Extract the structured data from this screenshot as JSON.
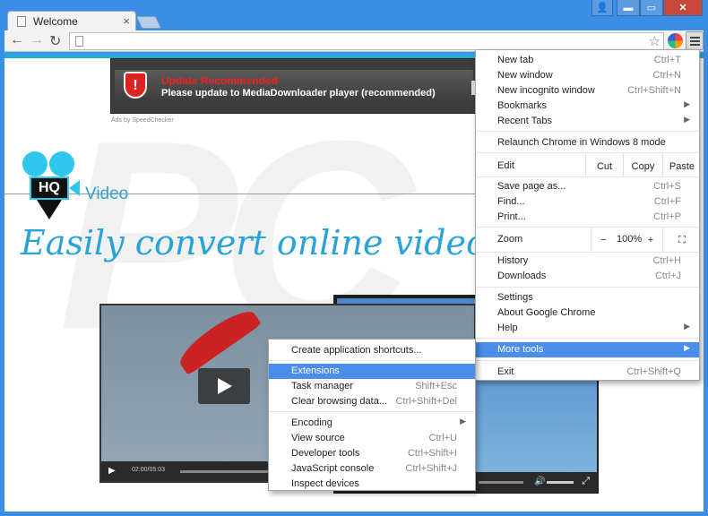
{
  "window": {
    "tab_title": "Welcome",
    "tab_close": "×",
    "controls": {
      "user": "👤",
      "minimize": "▬",
      "maximize": "▭",
      "close": "✕"
    }
  },
  "toolbar": {
    "back": "←",
    "forward": "→",
    "reload": "↻",
    "star": "☆"
  },
  "ad": {
    "title": "Update Recommended",
    "text": "Please update to MediaDownloader player (recommended)",
    "shield": "!",
    "attribution": "Ads by SpeedChecker"
  },
  "site": {
    "logo_badge": "HQ",
    "logo_text": "Video",
    "headline": "Easily convert online videos to M"
  },
  "player": {
    "play": "▶",
    "time": "02:00/05:03",
    "volume": "🔊",
    "fullscreen": "⤢"
  },
  "menu": {
    "new_tab": {
      "label": "New tab",
      "shortcut": "Ctrl+T"
    },
    "new_window": {
      "label": "New window",
      "shortcut": "Ctrl+N"
    },
    "new_incognito": {
      "label": "New incognito window",
      "shortcut": "Ctrl+Shift+N"
    },
    "bookmarks": {
      "label": "Bookmarks"
    },
    "recent_tabs": {
      "label": "Recent Tabs"
    },
    "relaunch": {
      "label": "Relaunch Chrome in Windows 8 mode"
    },
    "edit": {
      "label": "Edit",
      "cut": "Cut",
      "copy": "Copy",
      "paste": "Paste"
    },
    "save_page": {
      "label": "Save page as...",
      "shortcut": "Ctrl+S"
    },
    "find": {
      "label": "Find...",
      "shortcut": "Ctrl+F"
    },
    "print": {
      "label": "Print...",
      "shortcut": "Ctrl+P"
    },
    "zoom": {
      "label": "Zoom",
      "minus": "−",
      "value": "100%",
      "plus": "+",
      "fullscreen": "⛶"
    },
    "history": {
      "label": "History",
      "shortcut": "Ctrl+H"
    },
    "downloads": {
      "label": "Downloads",
      "shortcut": "Ctrl+J"
    },
    "settings": {
      "label": "Settings"
    },
    "about": {
      "label": "About Google Chrome"
    },
    "help": {
      "label": "Help"
    },
    "more_tools": {
      "label": "More tools"
    },
    "exit": {
      "label": "Exit",
      "shortcut": "Ctrl+Shift+Q"
    },
    "arrow": "▶"
  },
  "submenu": {
    "create_shortcuts": {
      "label": "Create application shortcuts..."
    },
    "extensions": {
      "label": "Extensions"
    },
    "task_manager": {
      "label": "Task manager",
      "shortcut": "Shift+Esc"
    },
    "clear_browsing": {
      "label": "Clear browsing data...",
      "shortcut": "Ctrl+Shift+Del"
    },
    "encoding": {
      "label": "Encoding"
    },
    "view_source": {
      "label": "View source",
      "shortcut": "Ctrl+U"
    },
    "developer_tools": {
      "label": "Developer tools",
      "shortcut": "Ctrl+Shift+I"
    },
    "js_console": {
      "label": "JavaScript console",
      "shortcut": "Ctrl+Shift+J"
    },
    "inspect_devices": {
      "label": "Inspect devices"
    }
  }
}
